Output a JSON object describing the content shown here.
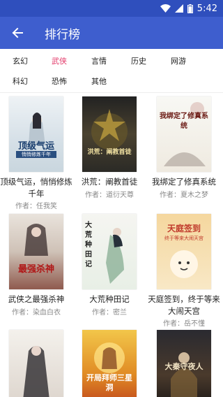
{
  "status_bar": {
    "time": "5:42"
  },
  "app_bar": {
    "title": "排行榜"
  },
  "categories": [
    {
      "label": "玄幻",
      "active": false
    },
    {
      "label": "武侠",
      "active": true
    },
    {
      "label": "言情",
      "active": false
    },
    {
      "label": "历史",
      "active": false
    },
    {
      "label": "网游",
      "active": false
    },
    {
      "label": "科幻",
      "active": false
    },
    {
      "label": "恐怖",
      "active": false
    },
    {
      "label": "其他",
      "active": false
    }
  ],
  "books": [
    {
      "title": "顶级气运，悄悄修炼千年",
      "author": "作者：任我笑",
      "cover_text": "顶级气运",
      "cover_sub": "悄悄修炼千年"
    },
    {
      "title": "洪荒：阐教首徒",
      "author": "作者：道衍天尊",
      "cover_text": "洪荒：阐教首徒"
    },
    {
      "title": "我绑定了修真系统",
      "author": "作者：夏木之梦",
      "cover_text": "我绑定了修真系统"
    },
    {
      "title": "武侠之最强杀神",
      "author": "作者：染血白衣",
      "cover_text": "最强杀神"
    },
    {
      "title": "大荒种田记",
      "author": "作者：密兰",
      "cover_text": "大荒种田记"
    },
    {
      "title": "天庭签到，终于等来大闹天宫",
      "author": "作者：岳不懂",
      "cover_text": "天庭签到",
      "cover_sub": "终于等来大闹天宫"
    },
    {
      "title": "",
      "author": "",
      "cover_text": ""
    },
    {
      "title": "",
      "author": "",
      "cover_text": "开局拜师三星洞"
    },
    {
      "title": "",
      "author": "",
      "cover_text": "大秦守夜人"
    }
  ],
  "colors": {
    "status_bar": "#2f4fbd",
    "app_bar": "#3e5ece",
    "active_tab": "#e33a6a"
  }
}
